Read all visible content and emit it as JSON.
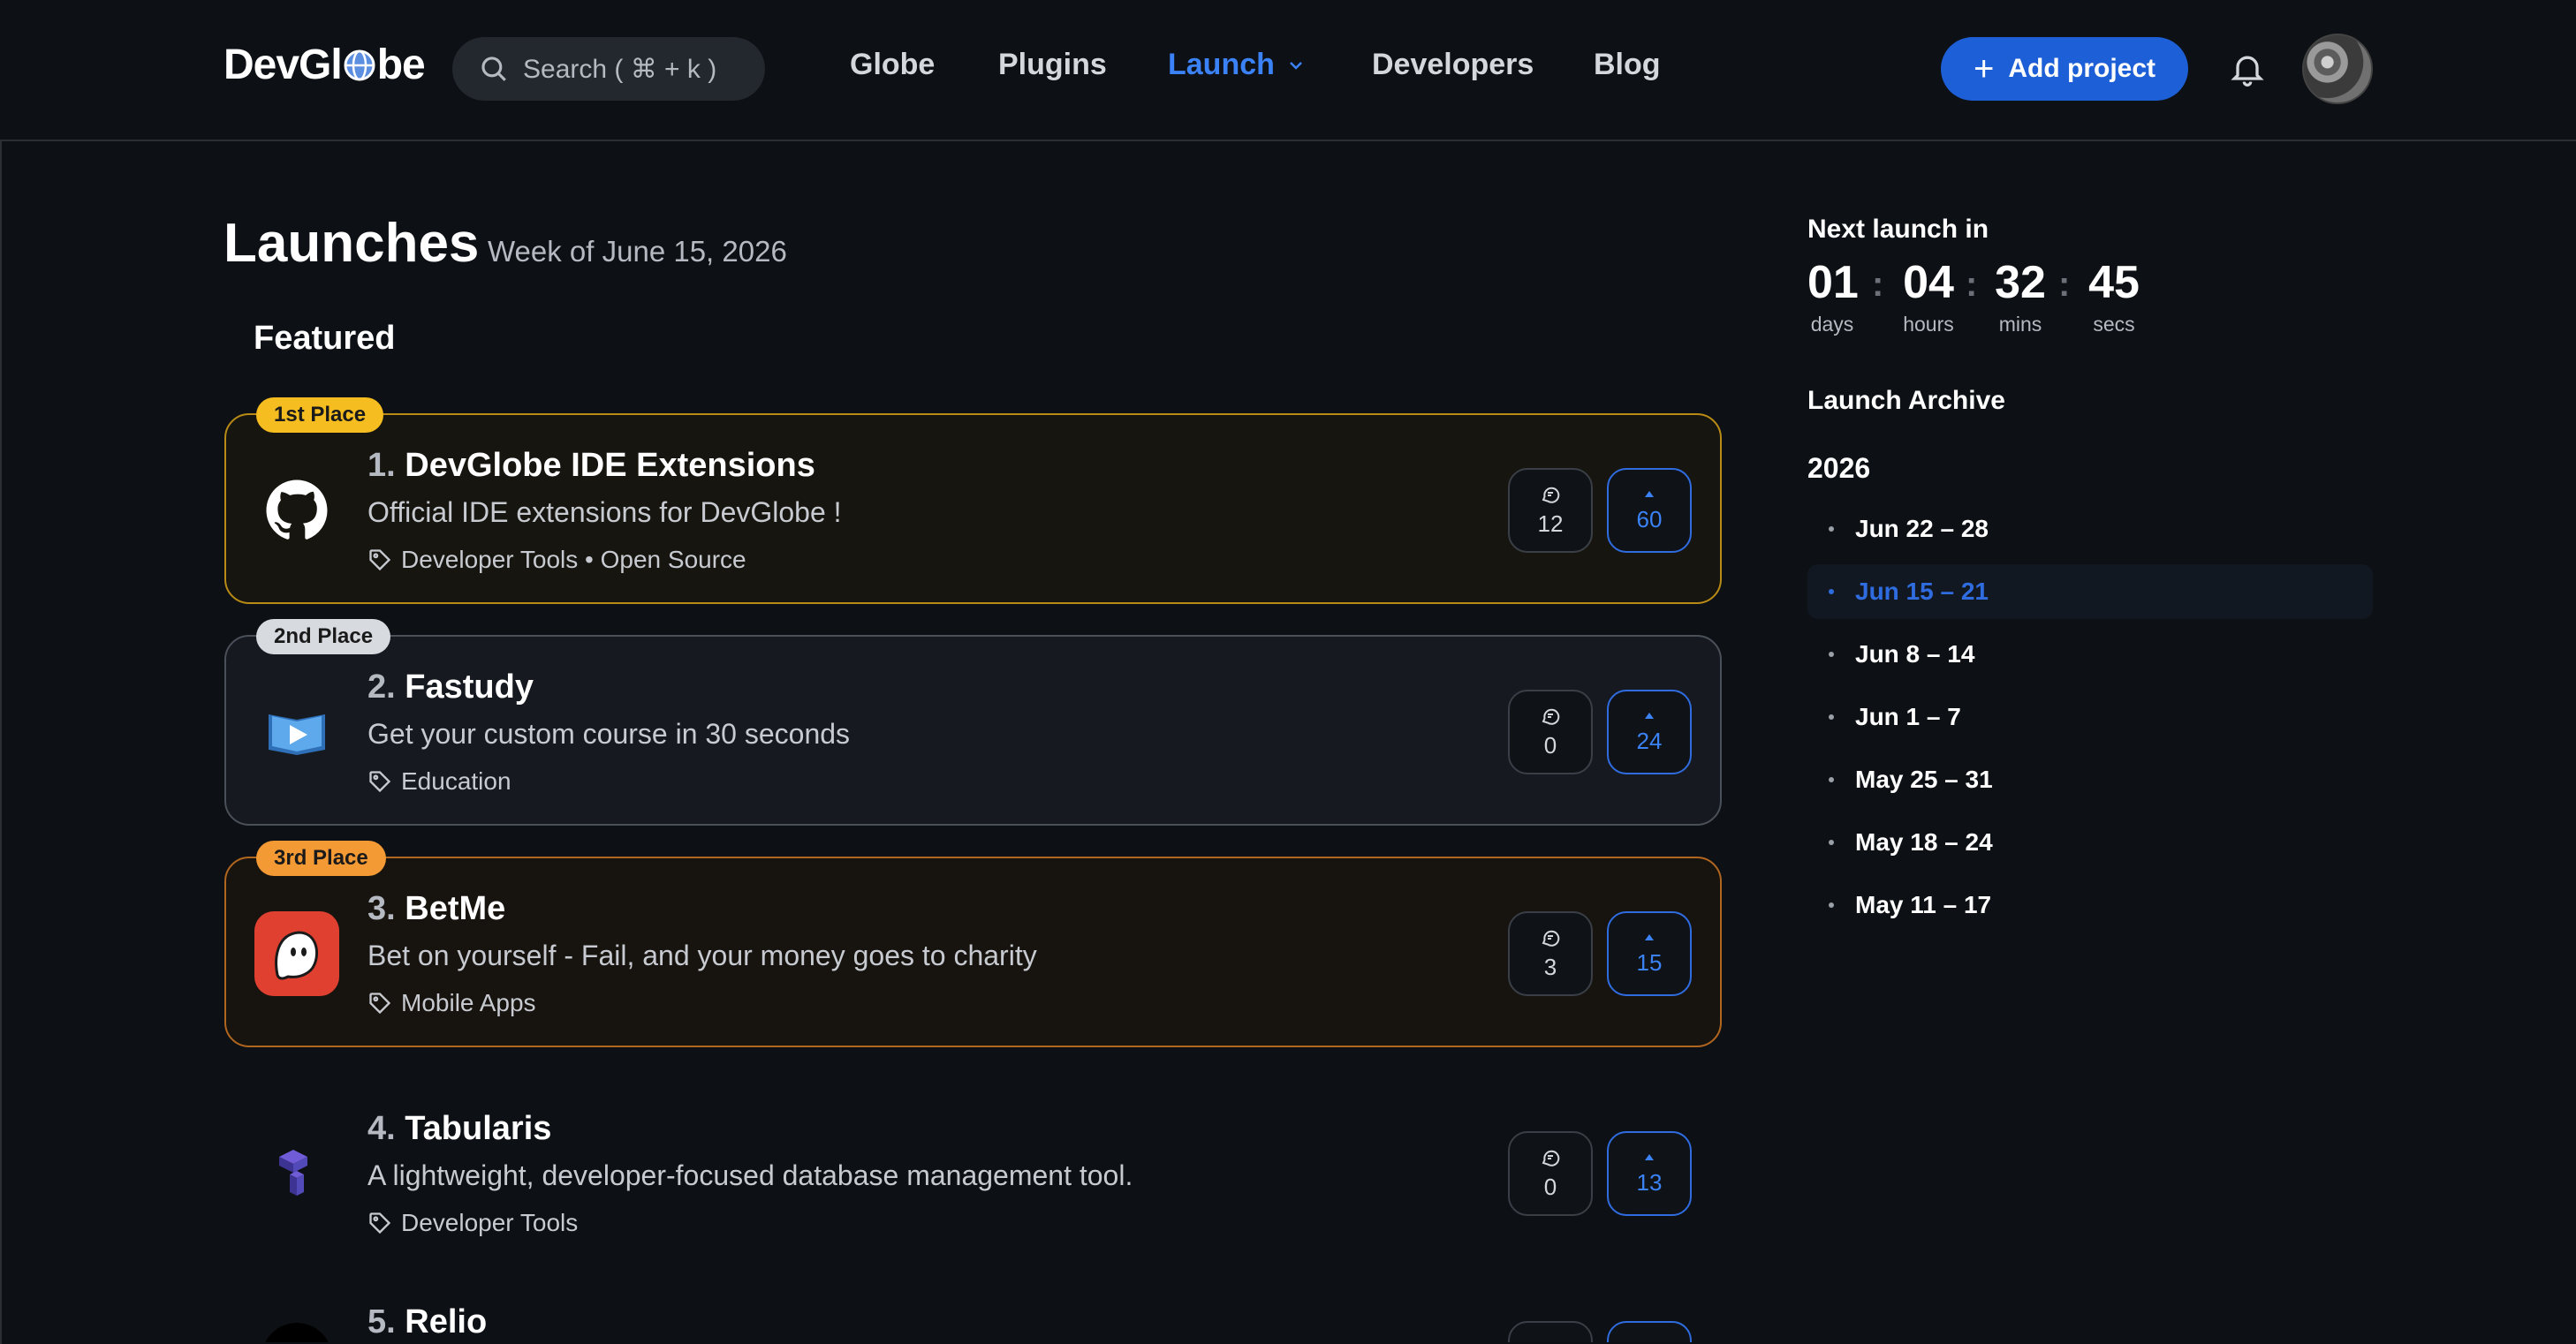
{
  "header": {
    "logo_pre": "DevGl",
    "logo_post": "be",
    "search_placeholder": "Search ( ⌘ + k )",
    "nav": [
      "Globe",
      "Plugins",
      "Launch",
      "Developers",
      "Blog"
    ],
    "active_nav": "Launch",
    "add_project": "Add project"
  },
  "page": {
    "title": "Launches",
    "subtitle": "Week of June 15, 2026",
    "section": "Featured"
  },
  "launches": [
    {
      "badge": "1st Place",
      "num": "1.",
      "name": "DevGlobe IDE Extensions",
      "desc": "Official IDE extensions for DevGlobe !",
      "tags": "Developer Tools • Open Source",
      "comments": "12",
      "votes": "60",
      "icon": "github-icon"
    },
    {
      "badge": "2nd Place",
      "num": "2.",
      "name": "Fastudy",
      "desc": "Get your custom course in 30 seconds",
      "tags": "Education",
      "comments": "0",
      "votes": "24",
      "icon": "play-book-icon"
    },
    {
      "badge": "3rd Place",
      "num": "3.",
      "name": "BetMe",
      "desc": "Bet on yourself - Fail, and your money goes to charity",
      "tags": "Mobile Apps",
      "comments": "3",
      "votes": "15",
      "icon": "ghost-icon"
    },
    {
      "badge": "",
      "num": "4.",
      "name": "Tabularis",
      "desc": "A lightweight, developer-focused database management tool.",
      "tags": "Developer Tools",
      "comments": "0",
      "votes": "13",
      "icon": "cube-logo-icon"
    },
    {
      "badge": "",
      "num": "5.",
      "name": "Relio",
      "desc": "",
      "tags": "",
      "comments": "",
      "votes": "",
      "icon": "circle-logo-icon"
    }
  ],
  "countdown": {
    "title": "Next launch in",
    "days": "01",
    "hours": "04",
    "mins": "32",
    "secs": "45",
    "days_label": "days",
    "hours_label": "hours",
    "mins_label": "mins",
    "secs_label": "secs"
  },
  "archive": {
    "title": "Launch Archive",
    "year": "2026",
    "weeks": [
      "Jun 22 – 28",
      "Jun 15 – 21",
      "Jun 8 – 14",
      "Jun 1 – 7",
      "May 25 – 31",
      "May 18 – 24",
      "May 11 – 17"
    ],
    "active_week": "Jun 15 – 21"
  },
  "colors": {
    "accent": "#1d5fd6",
    "link": "#3b82f6",
    "gold": "#f5bd1f",
    "silver": "#d7dbe0",
    "bronze": "#f39a34",
    "background": "#0d1014"
  }
}
